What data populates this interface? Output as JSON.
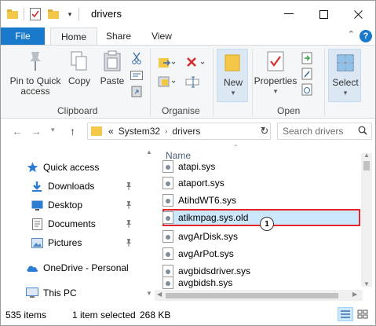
{
  "window": {
    "title": "drivers"
  },
  "ribbon_tabs": {
    "file": "File",
    "home": "Home",
    "share": "Share",
    "view": "View"
  },
  "clipboard": {
    "pin_to_quick_access_line1": "Pin to Quick",
    "pin_to_quick_access_line2": "access",
    "copy": "Copy",
    "paste": "Paste",
    "group_label": "Clipboard"
  },
  "organise": {
    "group_label": "Organise"
  },
  "new_group": {
    "new": "New"
  },
  "open_group": {
    "properties": "Properties",
    "group_label": "Open"
  },
  "select_group": {
    "select": "Select"
  },
  "address": {
    "prefix": "«",
    "crumbs": [
      "System32",
      "drivers"
    ]
  },
  "search": {
    "placeholder": "Search drivers"
  },
  "navpane": {
    "items": [
      {
        "label": "Quick access",
        "icon": "star-icon"
      },
      {
        "label": "Downloads",
        "icon": "download-icon"
      },
      {
        "label": "Desktop",
        "icon": "desktop-icon"
      },
      {
        "label": "Documents",
        "icon": "documents-icon"
      },
      {
        "label": "Pictures",
        "icon": "pictures-icon"
      },
      {
        "label": "OneDrive - Personal",
        "icon": "cloud-icon"
      },
      {
        "label": "This PC",
        "icon": "computer-icon"
      }
    ]
  },
  "filelist": {
    "column_name": "Name",
    "files": [
      "atapi.sys",
      "ataport.sys",
      "AtihdWT6.sys",
      "atikmpag.sys.old",
      "avgArDisk.sys",
      "avgArPot.sys",
      "avgbidsdriver.sys",
      "avgbidsh.sys"
    ],
    "selected_index": 3,
    "annotation_badge": "1"
  },
  "statusbar": {
    "item_count": "535 items",
    "selection": "1 item selected",
    "size": "268 KB"
  },
  "colors": {
    "accent": "#1979ca",
    "highlight_border": "#e8242b",
    "selection_fill": "#cce8ff",
    "folder": "#f3c747"
  }
}
